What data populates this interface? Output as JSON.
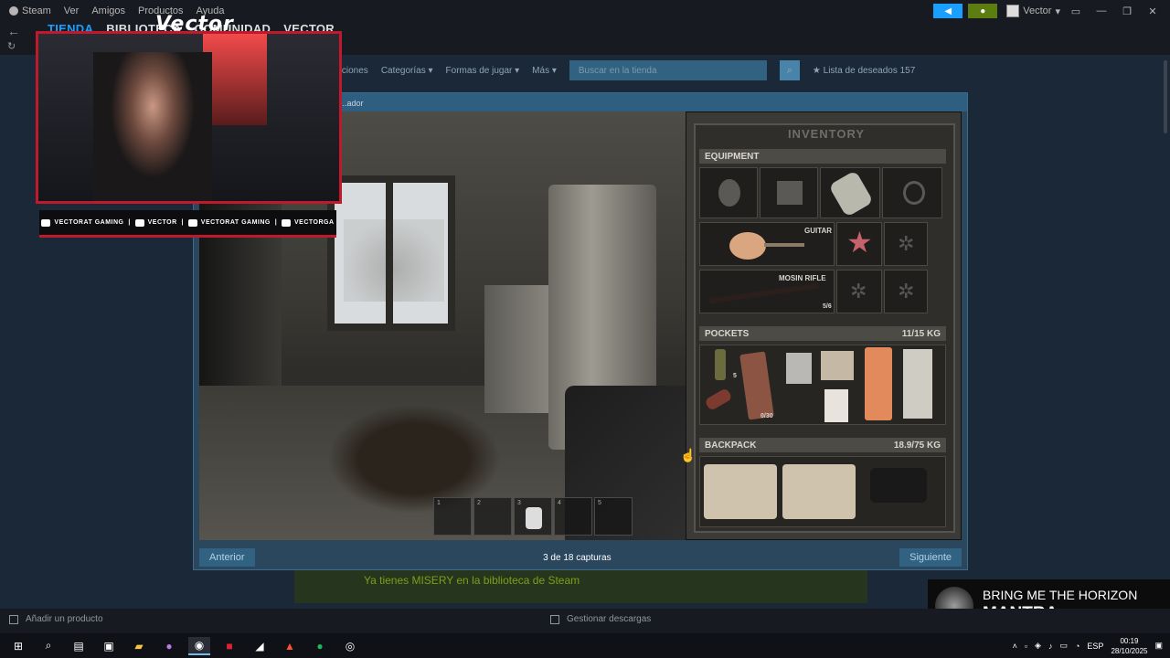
{
  "titlebar": {
    "menu": [
      "Steam",
      "Ver",
      "Amigos",
      "Productos",
      "Ayuda"
    ],
    "user": "Vector"
  },
  "nav": {
    "tabs": [
      "TIENDA",
      "BIBLIOTECA",
      "COMUNIDAD",
      "VECTOR"
    ]
  },
  "store": {
    "subnav": [
      "...aciones",
      "Categorías",
      "Formas de jugar",
      "Más"
    ],
    "search_placeholder": "Buscar en la tienda",
    "wishlist_label": "Lista de deseados",
    "wishlist_count": "157",
    "bottom_notice": "Ya tienes MISERY en la biblioteca de Steam"
  },
  "modal": {
    "header_link": "...ador",
    "prev_label": "Anterior",
    "next_label": "Siguiente",
    "counter": "3 de 18 capturas"
  },
  "inventory": {
    "title": "INVENTORY",
    "equipment_label": "EQUIPMENT",
    "guitar_label": "GUITAR",
    "rifle_label": "MOSIN RIFLE",
    "rifle_ammo": "5/6",
    "pockets_label": "POCKETS",
    "pockets_weight": "11/15 KG",
    "backpack_label": "BACKPACK",
    "backpack_weight": "18.9/75 KG",
    "pocket_count_1": "5",
    "pocket_count_2": "0/30",
    "hotbar_numbers": [
      "1",
      "2",
      "3",
      "4",
      "5"
    ]
  },
  "overlay": {
    "logo": "Vector",
    "socials": [
      "VECTORAT GAMING",
      "VECTOR",
      "VECTORAT GAMING",
      "VECTORGA"
    ]
  },
  "music": {
    "artist": "BRING ME THE HORIZON",
    "song": "MANTRA"
  },
  "footer": {
    "add_product": "Añadir un producto",
    "manage_downloads": "Gestionar descargas"
  },
  "taskbar": {
    "language": "ESP",
    "time": "00:19",
    "date": "28/10/2025"
  },
  "colors": {
    "steam_bg": "#1b2838",
    "steam_dark": "#171a21",
    "accent_blue": "#1a9fff",
    "overlay_red": "#c0192c"
  }
}
